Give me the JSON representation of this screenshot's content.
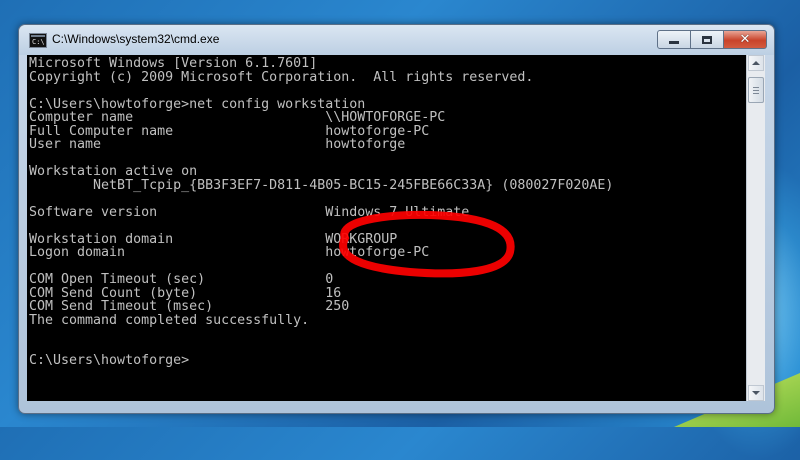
{
  "window": {
    "title": "C:\\Windows\\system32\\cmd.exe",
    "icon": "cmd-icon",
    "icon_text": "C:\\"
  },
  "controls": {
    "minimize_icon": "minimize-icon",
    "maximize_icon": "maximize-icon",
    "close_icon": "close-icon",
    "close_glyph": "✕"
  },
  "console": {
    "lines": [
      "Microsoft Windows [Version 6.1.7601]",
      "Copyright (c) 2009 Microsoft Corporation.  All rights reserved.",
      "",
      "C:\\Users\\howtoforge>net config workstation",
      "Computer name                        \\\\HOWTOFORGE-PC",
      "Full Computer name                   howtoforge-PC",
      "User name                            howtoforge",
      "",
      "Workstation active on",
      "        NetBT_Tcpip_{BB3F3EF7-D811-4B05-BC15-245FBE66C33A} (080027F020AE)",
      "",
      "Software version                     Windows 7 Ultimate",
      "",
      "Workstation domain                   WORKGROUP",
      "Logon domain                         howtoforge-PC",
      "",
      "COM Open Timeout (sec)               0",
      "COM Send Count (byte)                16",
      "COM Send Timeout (msec)              250",
      "The command completed successfully.",
      "",
      "",
      "C:\\Users\\howtoforge>"
    ]
  },
  "colors": {
    "console_bg": "#000000",
    "console_fg": "#c0c0c0",
    "annotation": "#ff0000",
    "close_button": "#c9432a"
  }
}
